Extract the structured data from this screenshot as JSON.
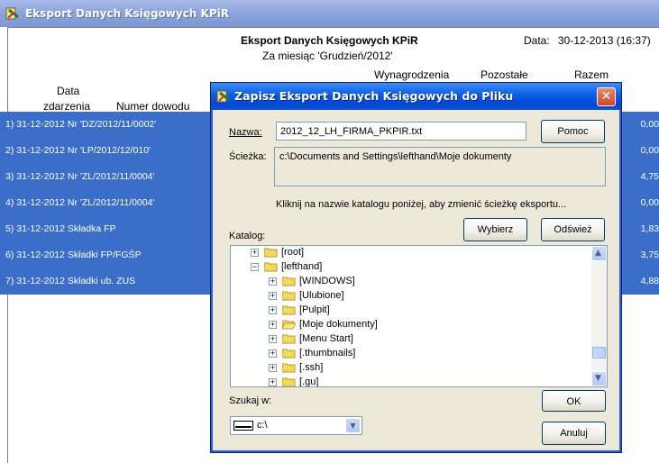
{
  "main": {
    "title": "Eksport Danych Księgowych KPiR",
    "report_title": "Eksport Danych Księgowych KPiR",
    "subtitle": "Za miesiąc 'Grudzień/2012'",
    "date_label": "Data:",
    "date_value": "30-12-2013 (16:37)",
    "columns": {
      "data_line1": "Data",
      "data_line2": "zdarzenia",
      "numer": "Numer dowodu",
      "wynagrodzenia": "Wynagrodzenia",
      "pozostale": "Pozostałe",
      "razem": "Razem"
    },
    "rows": [
      {
        "text": "1) 31-12-2012  Nr 'DZ/2012/11/0002'",
        "amount": "0,00"
      },
      {
        "text": "2) 31-12-2012  Nr 'LP/2012/12/010'",
        "amount": "0,00"
      },
      {
        "text": "3) 31-12-2012  Nr 'ZL/2012/11/0004'",
        "amount": "4,75"
      },
      {
        "text": "4) 31-12-2012  Nr 'ZL/2012/11/0004'",
        "amount": "0,00"
      },
      {
        "text": "5) 31-12-2012  Składka FP",
        "amount": "1,83"
      },
      {
        "text": "6) 31-12-2012  Składki FP/FGŚP",
        "amount": "3,75"
      },
      {
        "text": "7) 31-12-2012  Składki ub. ZUS",
        "amount": "4,88"
      }
    ]
  },
  "dialog": {
    "title": "Zapisz Eksport Danych Księgowych do Pliku",
    "close_glyph": "✕",
    "name_label": "Nazwa:",
    "name_value": "2012_12_LH_FIRMA_PKPIR.txt",
    "help_button": "Pomoc",
    "path_label": "Ścieżka:",
    "path_value": "c:\\Documents and Settings\\lefthand\\Moje dokumenty",
    "hint": "Kliknij na nazwie katalogu poniżej, aby zmienić ścieżkę eksportu...",
    "select_button": "Wybierz",
    "refresh_button": "Odśwież",
    "catalog_label": "Katalog:",
    "tree": [
      {
        "label": "[root]",
        "expander": "+"
      },
      {
        "label": "[lefthand]",
        "expander": "−"
      },
      {
        "label": "[WINDOWS]",
        "expander": "+"
      },
      {
        "label": "[Ulubione]",
        "expander": "+"
      },
      {
        "label": "[Pulpit]",
        "expander": "+"
      },
      {
        "label": "[Moje dokumenty]",
        "expander": "+"
      },
      {
        "label": "[Menu Start]",
        "expander": "+"
      },
      {
        "label": "[.thumbnails]",
        "expander": "+"
      },
      {
        "label": "[.ssh]",
        "expander": "+"
      },
      {
        "label": "[.gu]",
        "expander": "+"
      }
    ],
    "search_label": "Szukaj w:",
    "drive_value": "c:\\",
    "ok_button": "OK",
    "cancel_button": "Anuluj"
  },
  "colors": {
    "selection": "#3a6ec8",
    "dialog_bg": "#ece9d8",
    "titlebar": "#0a5ee3",
    "folder": "#f6d857"
  }
}
